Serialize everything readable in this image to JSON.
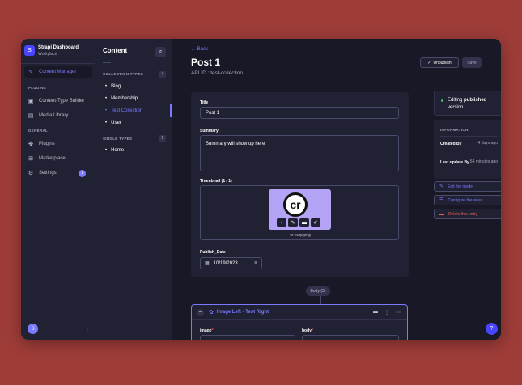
{
  "brand": {
    "title": "Strapi Dashboard",
    "subtitle": "Workplace",
    "logo": "S"
  },
  "nav": {
    "content_manager": "Content Manager",
    "plugins_section": "PLUGINS",
    "content_type_builder": "Content-Type Builder",
    "media_library": "Media Library",
    "general_section": "GENERAL",
    "plugins": "Plugins",
    "marketplace": "Marketplace",
    "settings": "Settings",
    "settings_badge": "1",
    "avatar": "S"
  },
  "subnav": {
    "title": "Content",
    "collection_section": "COLLECTION TYPES",
    "collection_count": "4",
    "collection_items": [
      "Blog",
      "Membership",
      "Test Collection",
      "User"
    ],
    "single_section": "SINGLE TYPES",
    "single_count": "1",
    "single_items": [
      "Home"
    ]
  },
  "header": {
    "back": "Back",
    "title": "Post 1",
    "api_id": "API ID : test-collection",
    "unpublish": "Unpublish",
    "save": "Save"
  },
  "form": {
    "title_label": "Title",
    "title_value": "Post 1",
    "summary_label": "Summary",
    "summary_value": "Summary will show up here",
    "thumbnail_label": "Thumbnail (1 / 1)",
    "thumbnail_logo": "cr",
    "thumbnail_name": "cr-purp.png",
    "publish_label": "Publish_Date",
    "publish_value": "10/19/2023"
  },
  "dynamic_zone": {
    "pill": "Body (3)",
    "component_title": "Image Left - Text Right",
    "image_label": "image",
    "body_label": "body"
  },
  "side": {
    "status_prefix": "Editing ",
    "status_highlight": "published",
    "status_suffix": "version",
    "info_title": "INFORMATION",
    "created_label": "Created By",
    "created_value": "4 days ago",
    "updated_label": "Last update By",
    "updated_value": "54 minutes ago",
    "edit_model": "Edit the model",
    "configure_view": "Configure the view",
    "delete_entry": "Delete this entry"
  },
  "colors": {
    "accent": "#7b79ff",
    "primary": "#4945ff",
    "danger": "#ee5e52",
    "success": "#5cb176",
    "background": "#9e3c38"
  }
}
